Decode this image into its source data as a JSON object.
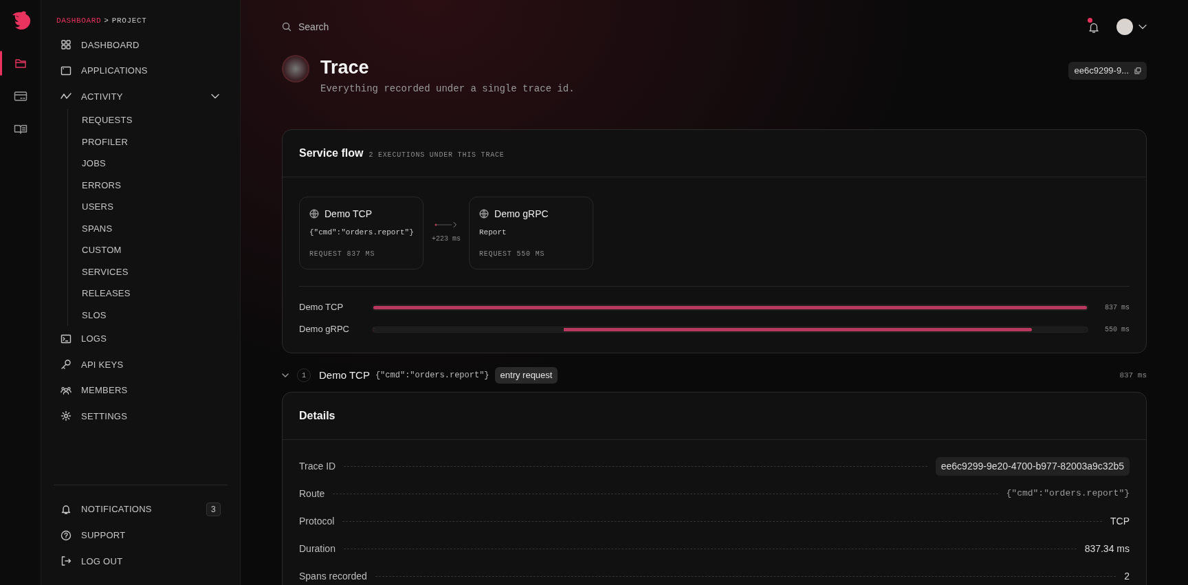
{
  "rail": [
    {
      "selected": true
    },
    {
      "selected": false
    },
    {
      "selected": false
    }
  ],
  "breadcrumb": [
    {
      "text": "DASHBOARD",
      "selected": false
    },
    {
      "text": "PROJECT",
      "selected": true
    }
  ],
  "breadcrumb_separator": ">",
  "nav": [
    {
      "label": "DASHBOARD"
    },
    {
      "label": "APPLICATIONS"
    },
    {
      "label": "ACTIVITY",
      "expanded": true,
      "children": [
        {
          "label": "REQUESTS"
        },
        {
          "label": "PROFILER"
        },
        {
          "label": "JOBS"
        },
        {
          "label": "ERRORS"
        },
        {
          "label": "USERS"
        },
        {
          "label": "SPANS"
        },
        {
          "label": "CUSTOM"
        },
        {
          "label": "SERVICES"
        },
        {
          "label": "RELEASES"
        },
        {
          "label": "SLOS"
        }
      ]
    },
    {
      "label": "LOGS"
    },
    {
      "label": "API KEYS"
    },
    {
      "label": "MEMBERS"
    },
    {
      "label": "SETTINGS"
    }
  ],
  "bottom_nav": [
    {
      "label": "NOTIFICATIONS",
      "badge": "3"
    },
    {
      "label": "SUPPORT"
    },
    {
      "label": "LOG OUT"
    }
  ],
  "search": {
    "placeholder": "Search"
  },
  "topbar": {
    "has_unread": true
  },
  "header": {
    "title": "Trace",
    "subtitle": "Everything recorded under a single trace id.",
    "trace_chip": "ee6c9299-9..."
  },
  "service_flow": {
    "title": "Service flow",
    "subtitle": "2 EXECUTIONS UNDER THIS TRACE",
    "nodes": [
      {
        "name": "Demo TCP",
        "route": "{\"cmd\":\"orders.report\"}",
        "meta": "REQUEST 837 MS"
      },
      {
        "name": "Demo gRPC",
        "route": "Report",
        "meta": "REQUEST 550 MS"
      }
    ],
    "connectors": [
      {
        "label": "+223 ms"
      }
    ],
    "bars": [
      {
        "name": "Demo TCP",
        "level": 1,
        "reading": "837 ms"
      },
      {
        "name": "Demo gRPC",
        "gap": {
          "level": 0.267
        },
        "level": 0.923,
        "reading": "550 ms"
      }
    ]
  },
  "execution": {
    "expanded": true,
    "index": "1",
    "name": "Demo TCP",
    "route": "{\"cmd\":\"orders.report\"}",
    "tag": "entry request",
    "duration": "837 ms"
  },
  "details": {
    "title": "Details",
    "rows": [
      {
        "label": "Trace ID",
        "value": "ee6c9299-9e20-4700-b977-82003a9c32b5",
        "kind": "pill"
      },
      {
        "label": "Route",
        "value": "{\"cmd\":\"orders.report\"}",
        "kind": "mono"
      },
      {
        "label": "Protocol",
        "value": "TCP",
        "kind": "plain"
      },
      {
        "label": "Duration",
        "value": "837.34 ms",
        "kind": "plain"
      },
      {
        "label": "Spans recorded",
        "value": "2",
        "kind": "plain"
      }
    ]
  }
}
